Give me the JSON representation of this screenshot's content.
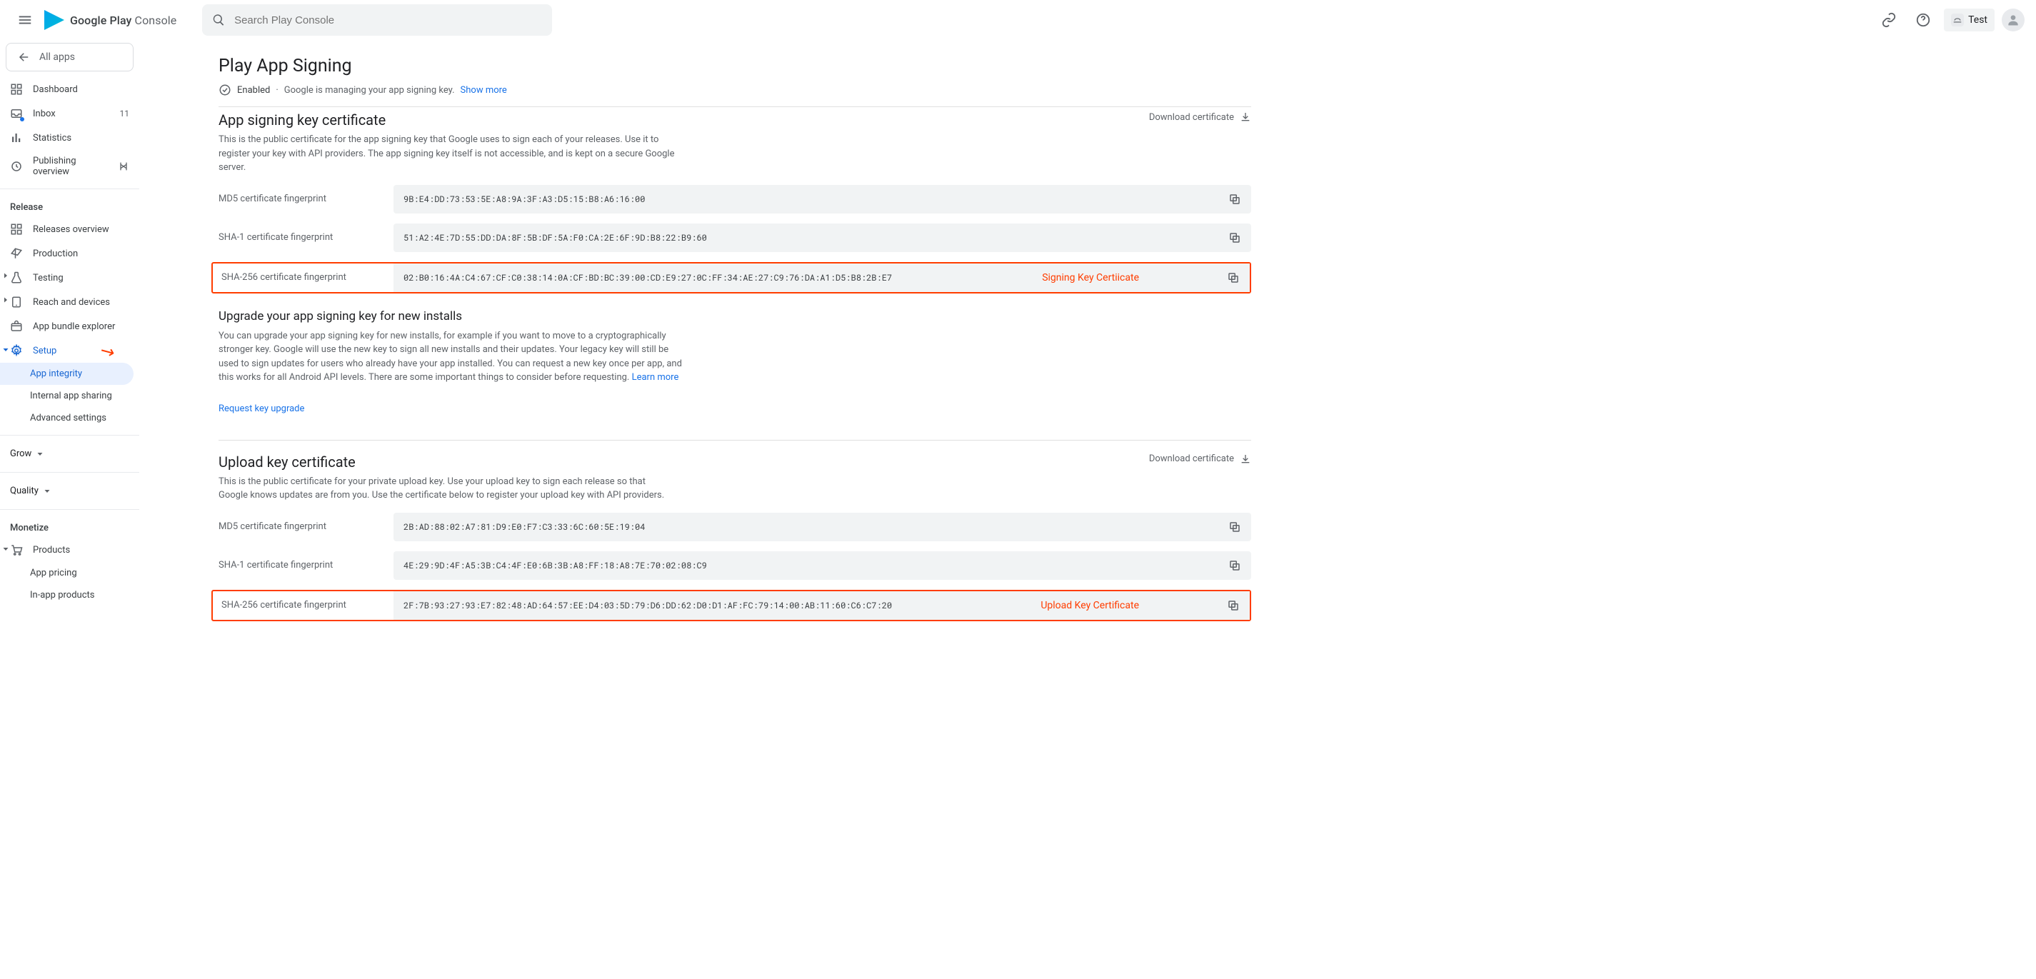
{
  "header": {
    "logo_text_1": "Google Play",
    "logo_text_2": " Console",
    "search_placeholder": "Search Play Console",
    "app_chip": "Test"
  },
  "sidebar": {
    "all_apps": "All apps",
    "dashboard": "Dashboard",
    "inbox": "Inbox",
    "inbox_count": "11",
    "statistics": "Statistics",
    "publishing_overview": "Publishing overview",
    "release_header": "Release",
    "releases_overview": "Releases overview",
    "production": "Production",
    "testing": "Testing",
    "reach_devices": "Reach and devices",
    "app_bundle": "App bundle explorer",
    "setup": "Setup",
    "app_integrity": "App integrity",
    "internal_sharing": "Internal app sharing",
    "advanced_settings": "Advanced settings",
    "grow": "Grow",
    "quality": "Quality",
    "monetize_header": "Monetize",
    "products": "Products",
    "app_pricing": "App pricing",
    "inapp_products": "In-app products"
  },
  "page": {
    "title": "Play App Signing",
    "status_enabled": "Enabled",
    "status_desc": "Google is managing your app signing key.",
    "show_more": "Show more"
  },
  "signing": {
    "title": "App signing key certificate",
    "desc": "This is the public certificate for the app signing key that Google uses to sign each of your releases. Use it to register your key with API providers. The app signing key itself is not accessible, and is kept on a secure Google server.",
    "download": "Download certificate",
    "md5_label": "MD5 certificate fingerprint",
    "md5_val": "9B:E4:DD:73:53:5E:A8:9A:3F:A3:D5:15:B8:A6:16:00",
    "sha1_label": "SHA-1 certificate fingerprint",
    "sha1_val": "51:A2:4E:7D:55:DD:DA:8F:5B:DF:5A:F0:CA:2E:6F:9D:B8:22:B9:60",
    "sha256_label": "SHA-256 certificate fingerprint",
    "sha256_val": "02:B0:16:4A:C4:67:CF:C0:38:14:0A:CF:BD:BC:39:00:CD:E9:27:0C:FF:34:AE:27:C9:76:DA:A1:D5:B8:2B:E7",
    "annot": "Signing Key Certiicate"
  },
  "upgrade": {
    "title": "Upgrade your app signing key for new installs",
    "desc": "You can upgrade your app signing key for new installs, for example if you want to move to a cryptographically stronger key. Google will use the new key to sign all new installs and their updates. Your legacy key will still be used to sign updates for users who already have your app installed. You can request a new key once per app, and this works for all Android API levels. There are some important things to consider before requesting. ",
    "learn_more": "Learn more",
    "request": "Request key upgrade"
  },
  "upload": {
    "title": "Upload key certificate",
    "desc": "This is the public certificate for your private upload key. Use your upload key to sign each release so that Google knows updates are from you. Use the certificate below to register your upload key with API providers.",
    "download": "Download certificate",
    "md5_label": "MD5 certificate fingerprint",
    "md5_val": "2B:AD:88:02:A7:81:D9:E0:F7:C3:33:6C:60:5E:19:04",
    "sha1_label": "SHA-1 certificate fingerprint",
    "sha1_val": "4E:29:9D:4F:A5:3B:C4:4F:E0:6B:3B:A8:FF:18:A8:7E:70:02:08:C9",
    "sha256_label": "SHA-256 certificate fingerprint",
    "sha256_val": "2F:7B:93:27:93:E7:82:48:AD:64:57:EE:D4:03:5D:79:D6:DD:62:D0:D1:AF:FC:79:14:00:AB:11:60:C6:C7:20",
    "annot": "Upload Key Certificate"
  }
}
